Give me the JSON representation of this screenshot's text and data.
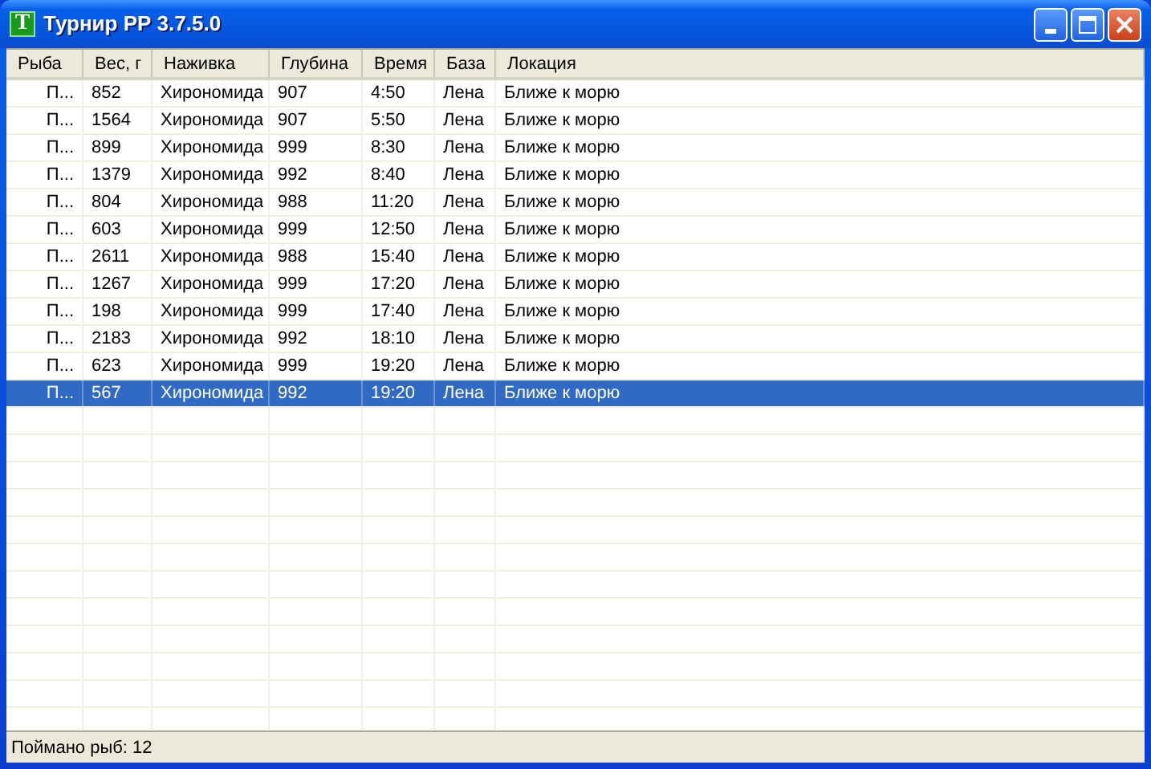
{
  "window": {
    "title": "Турнир РР 3.7.5.0",
    "icon_letter": "T"
  },
  "table": {
    "columns": [
      "Рыба",
      "Вес, г",
      "Наживка",
      "Глубина",
      "Время",
      "База",
      "Локация"
    ],
    "rows": [
      {
        "selected": false,
        "cells": [
          "П...",
          "852",
          "Хирономида",
          "907",
          "4:50",
          "Лена",
          "Ближе к морю"
        ]
      },
      {
        "selected": false,
        "cells": [
          "П...",
          "1564",
          "Хирономида",
          "907",
          "5:50",
          "Лена",
          "Ближе к морю"
        ]
      },
      {
        "selected": false,
        "cells": [
          "П...",
          "899",
          "Хирономида",
          "999",
          "8:30",
          "Лена",
          "Ближе к морю"
        ]
      },
      {
        "selected": false,
        "cells": [
          "П...",
          "1379",
          "Хирономида",
          "992",
          "8:40",
          "Лена",
          "Ближе к морю"
        ]
      },
      {
        "selected": false,
        "cells": [
          "П...",
          "804",
          "Хирономида",
          "988",
          "11:20",
          "Лена",
          "Ближе к морю"
        ]
      },
      {
        "selected": false,
        "cells": [
          "П...",
          "603",
          "Хирономида",
          "999",
          "12:50",
          "Лена",
          "Ближе к морю"
        ]
      },
      {
        "selected": false,
        "cells": [
          "П...",
          "2611",
          "Хирономида",
          "988",
          "15:40",
          "Лена",
          "Ближе к морю"
        ]
      },
      {
        "selected": false,
        "cells": [
          "П...",
          "1267",
          "Хирономида",
          "999",
          "17:20",
          "Лена",
          "Ближе к морю"
        ]
      },
      {
        "selected": false,
        "cells": [
          "П...",
          "198",
          "Хирономида",
          "999",
          "17:40",
          "Лена",
          "Ближе к морю"
        ]
      },
      {
        "selected": false,
        "cells": [
          "П...",
          "2183",
          "Хирономида",
          "992",
          "18:10",
          "Лена",
          "Ближе к морю"
        ]
      },
      {
        "selected": false,
        "cells": [
          "П...",
          "623",
          "Хирономида",
          "999",
          "19:20",
          "Лена",
          "Ближе к морю"
        ]
      },
      {
        "selected": true,
        "cells": [
          "П...",
          "567",
          "Хирономида",
          "992",
          "19:20",
          "Лена",
          "Ближе к морю"
        ]
      }
    ]
  },
  "status_bar": "Поймано рыб: 12"
}
